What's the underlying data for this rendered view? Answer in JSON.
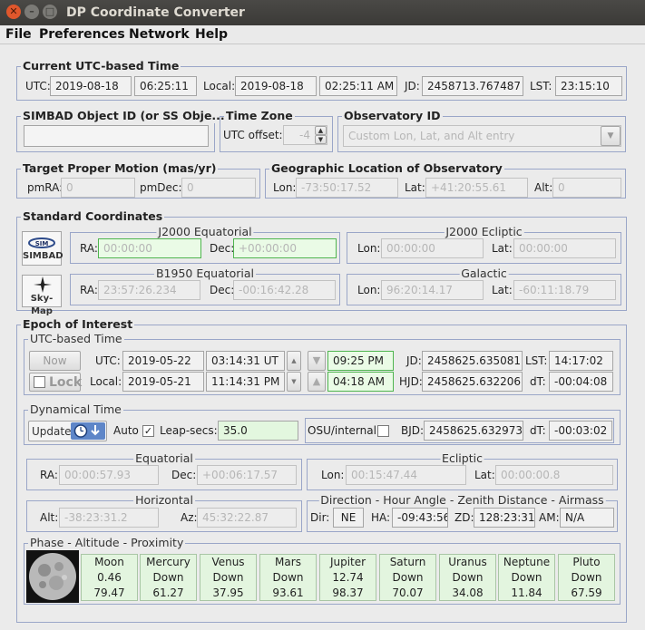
{
  "window": {
    "title": "DP Coordinate Converter"
  },
  "menu": [
    "File",
    "Preferences",
    "Network",
    "Help"
  ],
  "utc": {
    "title": "Current UTC-based Time",
    "utc_label": "UTC:",
    "utc_date": "2019-08-18",
    "utc_time": "06:25:11",
    "local_label": "Local:",
    "local_date": "2019-08-18",
    "local_time": "02:25:11 AM",
    "jd_label": "JD:",
    "jd": "2458713.767487",
    "lst_label": "LST:",
    "lst": "23:15:10"
  },
  "simbad": {
    "title": "SIMBAD Object ID (or SS Obje...",
    "value": ""
  },
  "timezone": {
    "title": "Time Zone",
    "label": "UTC offset:",
    "value": "-4"
  },
  "observatory": {
    "title": "Observatory ID",
    "value": "Custom Lon, Lat, and Alt entry"
  },
  "proper_motion": {
    "title": "Target Proper Motion (mas/yr)",
    "pmra_label": "pmRA:",
    "pmra": "0",
    "pmdec_label": "pmDec:",
    "pmdec": "0"
  },
  "geo": {
    "title": "Geographic Location of Observatory",
    "lon_label": "Lon:",
    "lon": "-73:50:17.52",
    "lat_label": "Lat:",
    "lat": "+41:20:55.61",
    "alt_label": "Alt:",
    "alt": "0"
  },
  "standard": {
    "title": "Standard Coordinates",
    "simbad_button": "SIMBAD",
    "skymap_button": "Sky-Map",
    "j2000eq": {
      "title": "J2000 Equatorial",
      "ra_label": "RA:",
      "ra": "00:00:00",
      "dec_label": "Dec:",
      "dec": "+00:00:00"
    },
    "j2000ec": {
      "title": "J2000 Ecliptic",
      "lon_label": "Lon:",
      "lon": "00:00:00",
      "lat_label": "Lat:",
      "lat": "00:00:00"
    },
    "b1950": {
      "title": "B1950 Equatorial",
      "ra_label": "RA:",
      "ra": "23:57:26.234",
      "dec_label": "Dec:",
      "dec": "-00:16:42.28"
    },
    "galactic": {
      "title": "Galactic",
      "lon_label": "Lon:",
      "lon": "96:20:14.17",
      "lat_label": "Lat:",
      "lat": "-60:11:18.79"
    }
  },
  "epoch": {
    "title": "Epoch of Interest",
    "utc": {
      "title": "UTC-based Time",
      "now_button": "Now",
      "lock_label": "Lock",
      "utc_label": "UTC:",
      "utc_date": "2019-05-22",
      "utc_time": "03:14:31 UT",
      "local_label": "Local:",
      "local_date": "2019-05-21",
      "local_time": "11:14:31 PM",
      "time1": "09:25 PM",
      "time2": "04:18 AM",
      "jd_label": "JD:",
      "jd": "2458625.635081",
      "lst_label": "LST:",
      "lst": "14:17:02",
      "hjd_label": "HJD:",
      "hjd": "2458625.632206",
      "dt_label": "dT:",
      "dt": "-00:04:08"
    },
    "dynamical": {
      "title": "Dynamical Time",
      "update_label": "Update",
      "auto_label": "Auto",
      "leap_label": "Leap-secs:",
      "leap": "35.0",
      "osu_label": "OSU/internal",
      "bjd_label": "BJD:",
      "bjd": "2458625.632973",
      "dt_label": "dT:",
      "dt": "-00:03:02"
    },
    "equatorial": {
      "title": "Equatorial",
      "ra_label": "RA:",
      "ra": "00:00:57.93",
      "dec_label": "Dec:",
      "dec": "+00:06:17.57"
    },
    "ecliptic": {
      "title": "Ecliptic",
      "lon_label": "Lon:",
      "lon": "00:15:47.44",
      "lat_label": "Lat:",
      "lat": "00:00:00.8"
    },
    "horizontal": {
      "title": "Horizontal",
      "alt_label": "Alt:",
      "alt": "-38:23:31.2",
      "az_label": "Az:",
      "az": "45:32:22.87"
    },
    "direction": {
      "title": "Direction - Hour Angle - Zenith Distance - Airmass",
      "dir_label": "Dir:",
      "dir": "NE",
      "ha_label": "HA:",
      "ha": "-09:43:56",
      "zd_label": "ZD:",
      "zd": "128:23:31",
      "am_label": "AM:",
      "am": "N/A"
    },
    "phase": {
      "title": "Phase - Altitude - Proximity",
      "bodies": [
        {
          "name": "Moon",
          "v1": "0.46",
          "v2": "79.47"
        },
        {
          "name": "Mercury",
          "v1": "Down",
          "v2": "61.27"
        },
        {
          "name": "Venus",
          "v1": "Down",
          "v2": "37.95"
        },
        {
          "name": "Mars",
          "v1": "Down",
          "v2": "93.61"
        },
        {
          "name": "Jupiter",
          "v1": "12.74",
          "v2": "98.37"
        },
        {
          "name": "Saturn",
          "v1": "Down",
          "v2": "70.07"
        },
        {
          "name": "Uranus",
          "v1": "Down",
          "v2": "34.08"
        },
        {
          "name": "Neptune",
          "v1": "Down",
          "v2": "11.84"
        },
        {
          "name": "Pluto",
          "v1": "Down",
          "v2": "67.59"
        }
      ]
    }
  }
}
